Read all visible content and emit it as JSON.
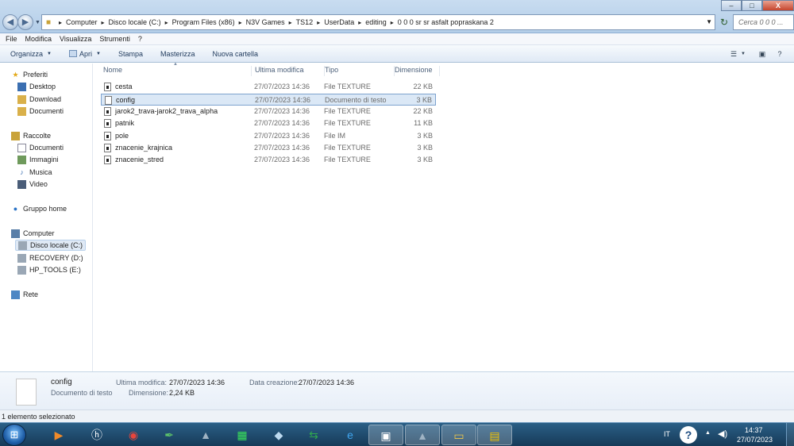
{
  "window": {
    "address_crumbs": [
      "Computer",
      "Disco locale (C:)",
      "Program Files (x86)",
      "N3V Games",
      "TS12",
      "UserData",
      "editing",
      "0 0 0 sr sr asfalt popraskana 2"
    ],
    "search_placeholder": "Cerca 0 0 0 ...",
    "controls": [
      "–",
      "□",
      "X"
    ]
  },
  "menu": [
    "File",
    "Modifica",
    "Visualizza",
    "Strumenti",
    "?"
  ],
  "toolbar": {
    "organize": "Organizza",
    "open": "Apri",
    "print": "Stampa",
    "burn": "Masterizza",
    "new_folder": "Nuova cartella"
  },
  "nav": {
    "favorites": "Preferiti",
    "favorites_items": [
      "Desktop",
      "Download",
      "Documenti"
    ],
    "libraries": "Raccolte",
    "libraries_items": [
      "Documenti",
      "Immagini",
      "Musica",
      "Video"
    ],
    "homegroup": "Gruppo home",
    "computer": "Computer",
    "computer_items": [
      "Disco locale (C:)",
      "RECOVERY (D:)",
      "HP_TOOLS (E:)"
    ],
    "network": "Rete"
  },
  "columns": {
    "name": "Nome",
    "modified": "Ultima modifica",
    "type": "Tipo",
    "size": "Dimensione"
  },
  "files": [
    {
      "name": "cesta",
      "modified": "27/07/2023 14:36",
      "type": "File TEXTURE",
      "size": "22 KB"
    },
    {
      "name": "config",
      "modified": "27/07/2023 14:36",
      "type": "Documento di testo",
      "size": "3 KB"
    },
    {
      "name": "jarok2_trava-jarok2_trava_alpha",
      "modified": "27/07/2023 14:36",
      "type": "File TEXTURE",
      "size": "22 KB"
    },
    {
      "name": "patnik",
      "modified": "27/07/2023 14:36",
      "type": "File TEXTURE",
      "size": "11 KB"
    },
    {
      "name": "pole",
      "modified": "27/07/2023 14:36",
      "type": "File IM",
      "size": "3 KB"
    },
    {
      "name": "znacenie_krajnica",
      "modified": "27/07/2023 14:36",
      "type": "File TEXTURE",
      "size": "3 KB"
    },
    {
      "name": "znacenie_stred",
      "modified": "27/07/2023 14:36",
      "type": "File TEXTURE",
      "size": "3 KB"
    }
  ],
  "details": {
    "name": "config",
    "type": "Documento di testo",
    "modified_label": "Ultima modifica:",
    "modified_value": "27/07/2023 14:36",
    "size_label": "Dimensione:",
    "size_value": "2,24 KB",
    "created_label": "Data creazione:",
    "created_value": "27/07/2023 14:36"
  },
  "status": "1 elemento selezionato",
  "taskbar": {
    "icons": [
      "media-player-icon",
      "hp-icon",
      "chrome-icon",
      "quill-icon",
      "game-launcher-icon",
      "grid-app-icon",
      "cube-app-icon",
      "excel-icon",
      "internet-explorer-icon",
      "window-app-icon",
      "game-launcher-icon",
      "explorer-folder-icon",
      "truck-game-icon"
    ],
    "lang": "IT",
    "time": "14:37",
    "date": "27/07/2023"
  }
}
